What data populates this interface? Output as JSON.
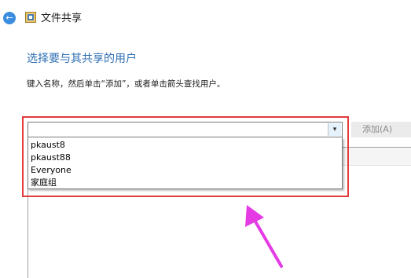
{
  "window": {
    "title": "文件共享",
    "back_glyph": "←"
  },
  "main": {
    "heading": "选择要与其共享的用户",
    "instruction": "键入名称，然后单击“添加”，或者单击箭头查找用户。",
    "user_input": {
      "value": "",
      "placeholder": ""
    },
    "dropdown_arrow_glyph": "▾",
    "add_button_label": "添加(A)",
    "dropdown_options": [
      "pkaust8",
      "pkaust88",
      "Everyone",
      "家庭组"
    ]
  },
  "colors": {
    "accent": "#2f6fb3",
    "highlight": "#e33b3b",
    "pointer_arrow": "#e53be5"
  }
}
